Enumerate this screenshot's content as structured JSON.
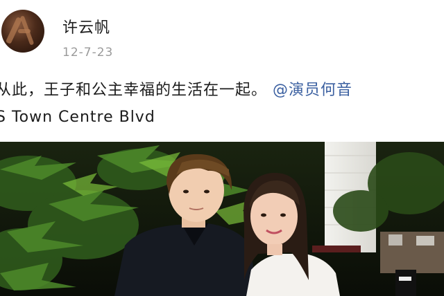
{
  "post": {
    "author_name": "许云帆",
    "date": "12-7-23",
    "text_main": "从此，王子和公主幸福的生活在一起。",
    "mention": "@演员何音",
    "location": "S Town Centre Blvd"
  },
  "photo": {
    "icon": "photo-of-two-people"
  },
  "colors": {
    "mention": "#3a5fa0",
    "date": "#9a9a9a",
    "text": "#1b1b1b"
  }
}
